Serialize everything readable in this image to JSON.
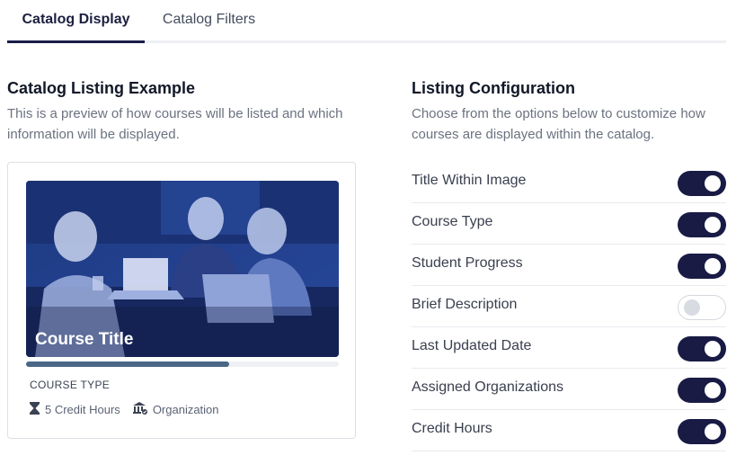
{
  "tabs": [
    {
      "label": "Catalog Display",
      "active": true
    },
    {
      "label": "Catalog Filters",
      "active": false
    }
  ],
  "preview": {
    "title": "Catalog Listing Example",
    "description": "This is a preview of how courses will be listed and which information will be displayed.",
    "card": {
      "course_title": "Course Title",
      "progress_fraction": 0.65,
      "course_type": "COURSE TYPE",
      "credit_hours": "5 Credit Hours",
      "organization": "Organization",
      "icons": [
        "hourglass-icon",
        "organization-icon"
      ]
    }
  },
  "config": {
    "title": "Listing Configuration",
    "description": "Choose from the options below to customize how courses are displayed within the catalog.",
    "options": [
      {
        "label": "Title Within Image",
        "enabled": true
      },
      {
        "label": "Course Type",
        "enabled": true
      },
      {
        "label": "Student Progress",
        "enabled": true
      },
      {
        "label": "Brief Description",
        "enabled": false
      },
      {
        "label": "Last Updated Date",
        "enabled": true
      },
      {
        "label": "Assigned Organizations",
        "enabled": true
      },
      {
        "label": "Credit Hours",
        "enabled": true
      }
    ]
  },
  "colors": {
    "accent": "#191b45",
    "image_tint": "#2a4a9c",
    "progress": "#4b6787"
  }
}
